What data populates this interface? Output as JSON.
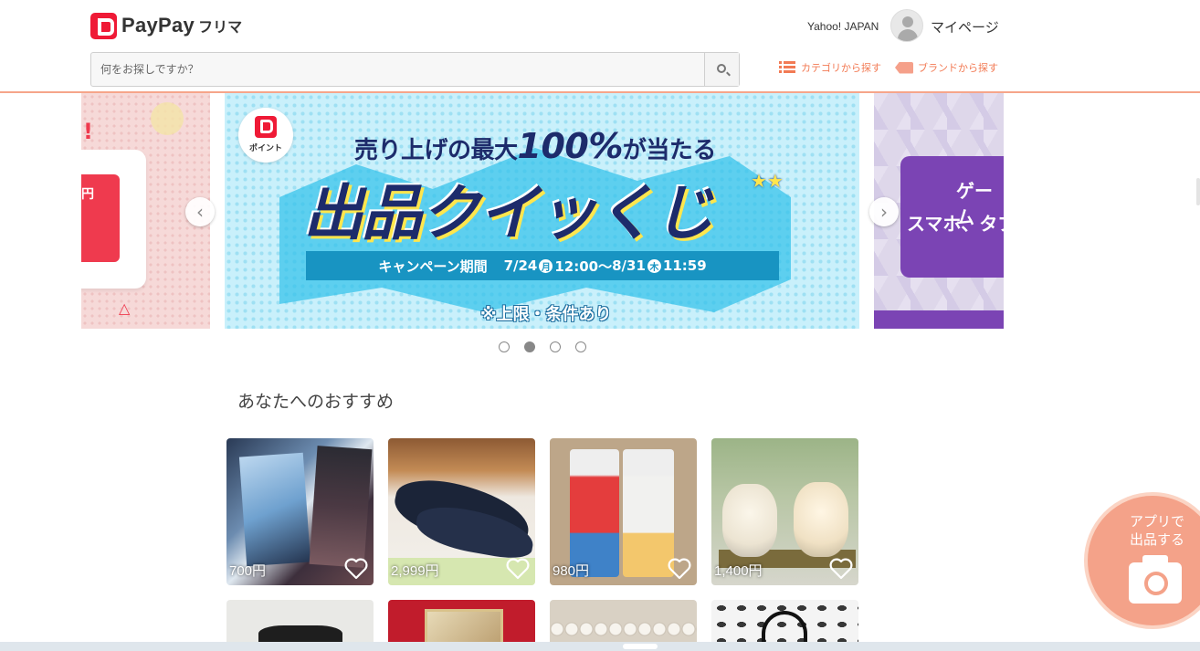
{
  "header": {
    "logo_text": "PayPay",
    "logo_sub": "フリマ",
    "yahoo_link": "Yahoo! JAPAN",
    "mypage_label": "マイページ",
    "search_placeholder": "何をお探しですか？",
    "category_link": "カテゴリから探す",
    "brand_link": "ブランドから探す",
    "accent_color": "#f27a54"
  },
  "carousel": {
    "main_slide": {
      "badge_text": "ポイント",
      "line1_prefix": "売り上げの最大",
      "line1_big": "100%",
      "line1_suffix": "が当たる",
      "title": "出品クイッくじ",
      "period_label": "キャンペーン期間",
      "period_start": "7/24",
      "start_day": "月",
      "start_time": "12:00〜",
      "period_end": "8/31",
      "end_day": "木",
      "end_time": "11:59",
      "note": "※上限・条件あり"
    },
    "left_slide": {
      "yen_text": "円"
    },
    "right_slide": {
      "text1": "ゲーム",
      "text2": "スマホ、タブ"
    },
    "prev_icon": "chevron-left",
    "next_icon": "chevron-right",
    "active_index": 1,
    "slide_count": 4
  },
  "recommend": {
    "title": "あなたへのおすすめ",
    "items": [
      {
        "price": "700円"
      },
      {
        "price": "2,999円"
      },
      {
        "price": "980円"
      },
      {
        "price": "1,400円"
      },
      {
        "price": ""
      },
      {
        "price": ""
      },
      {
        "price": ""
      },
      {
        "price": ""
      }
    ]
  },
  "sell_button": {
    "line1": "アプリで",
    "line2": "出品する"
  }
}
